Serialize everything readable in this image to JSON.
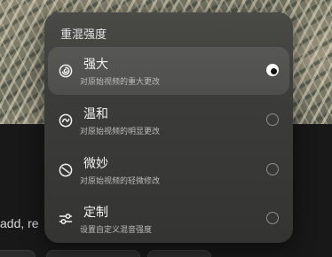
{
  "background": {
    "input_text_partial": "add, re"
  },
  "menu": {
    "title": "重混强度",
    "options": [
      {
        "label": "强大",
        "description": "对原始视频的重大更改",
        "icon": "spiral-strong-icon",
        "selected": true
      },
      {
        "label": "温和",
        "description": "对原始视频的明显更改",
        "icon": "spiral-moderate-icon",
        "selected": false
      },
      {
        "label": "微妙",
        "description": "对原始视频的轻微修改",
        "icon": "spiral-subtle-icon",
        "selected": false
      },
      {
        "label": "定制",
        "description": "设置自定义混音强度",
        "icon": "sliders-icon",
        "selected": false
      }
    ]
  },
  "colors": {
    "menu_bg": "#3c3c3a",
    "selected_row_bg": "#4e4e4c",
    "text_primary": "#f2f2f2",
    "text_secondary": "#bdbdbd",
    "radio_checked": "#ffffff"
  }
}
